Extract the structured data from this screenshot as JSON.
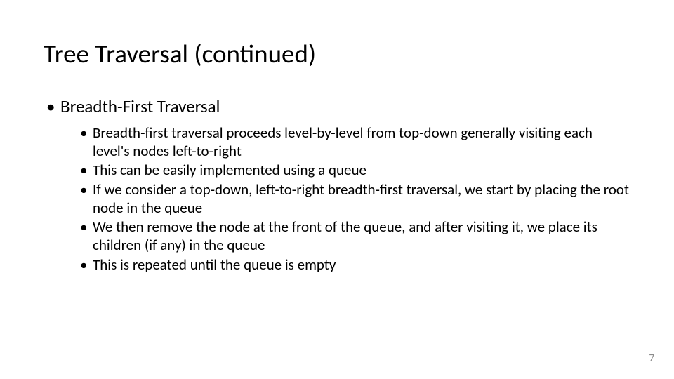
{
  "title": "Tree Traversal (continued)",
  "heading": "Breadth-First Traversal",
  "bullets": [
    "Breadth-first traversal proceeds level-by-level from top-down generally visiting each level's nodes left-to-right",
    "This can be easily implemented using a queue",
    "If we consider a top-down, left-to-right breadth-first traversal, we start by placing the root node in the queue",
    "We then remove the node at the front of the queue, and after visiting it, we place its children (if any) in the queue",
    "This is repeated until the queue is empty"
  ],
  "page_number": "7"
}
